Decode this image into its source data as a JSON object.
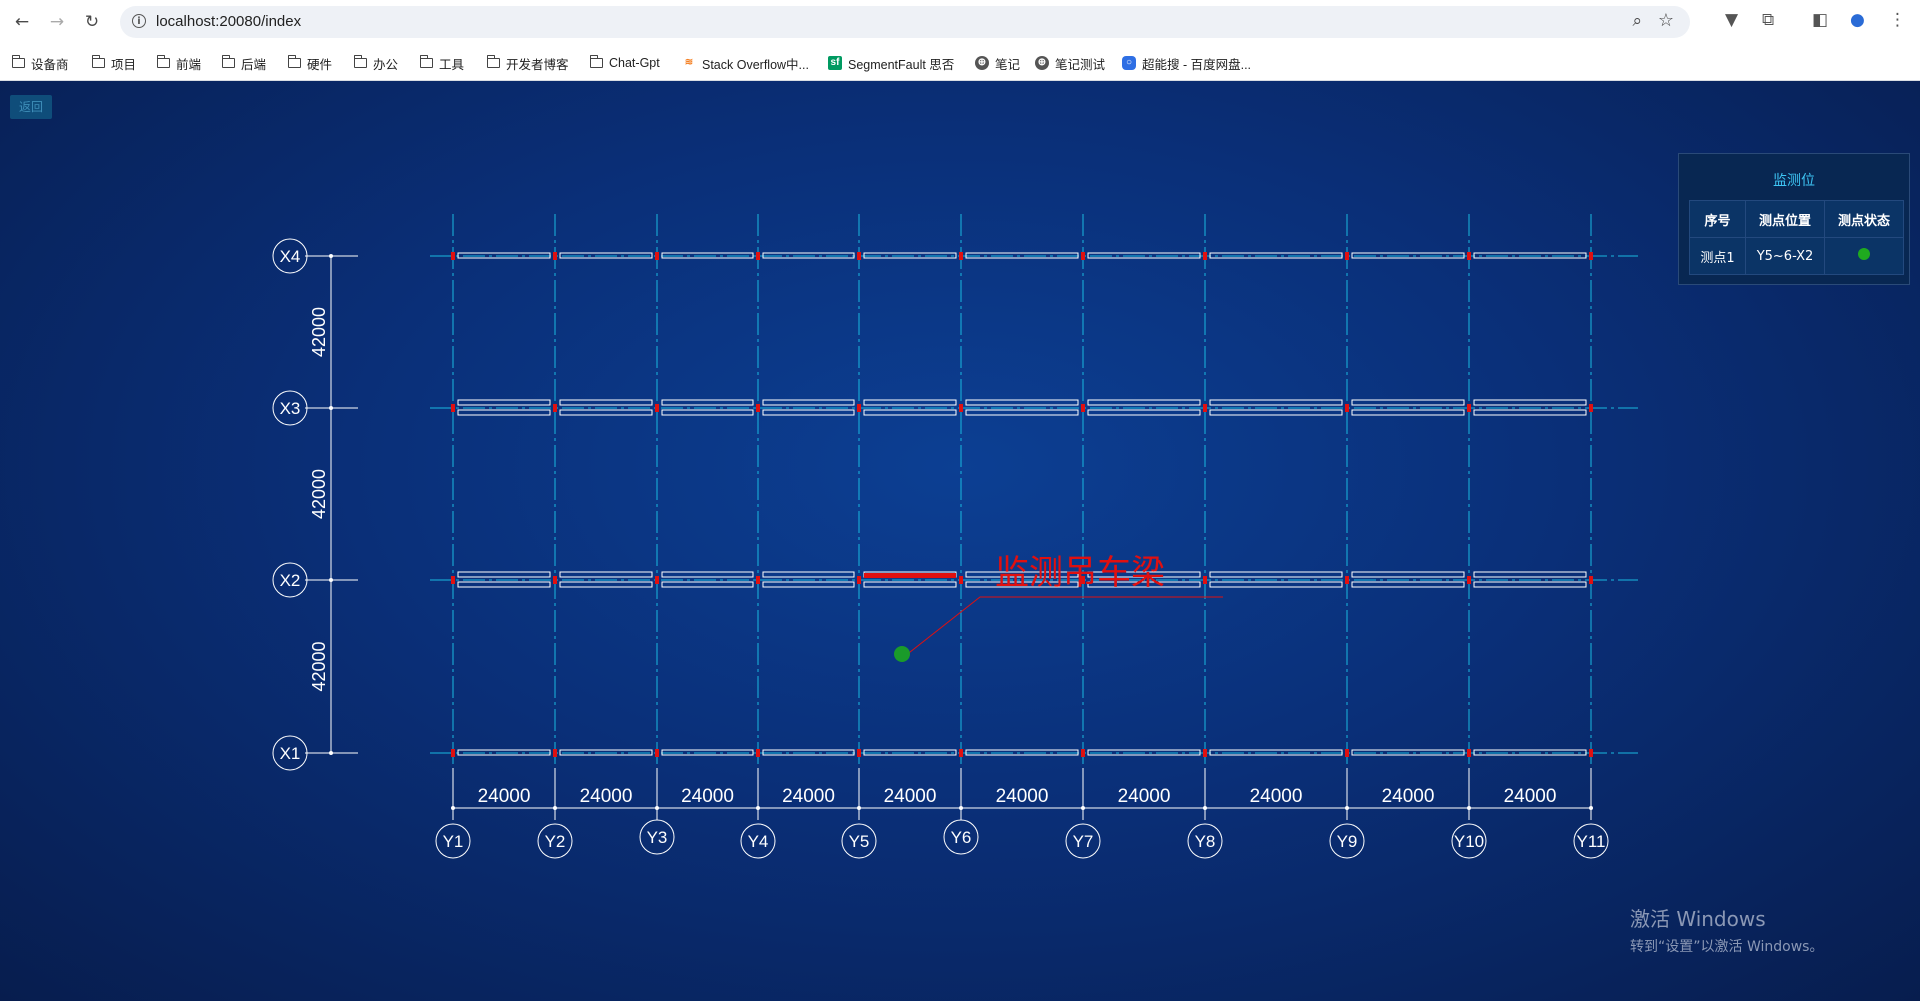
{
  "browser": {
    "url": "localhost:20080/index",
    "bookmarks": [
      {
        "label": "设备商",
        "icon": "folder-icon"
      },
      {
        "label": "项目",
        "icon": "folder-icon"
      },
      {
        "label": "前端",
        "icon": "folder-icon"
      },
      {
        "label": "后端",
        "icon": "folder-icon"
      },
      {
        "label": "硬件",
        "icon": "folder-icon"
      },
      {
        "label": "办公",
        "icon": "folder-icon"
      },
      {
        "label": "工具",
        "icon": "folder-icon"
      },
      {
        "label": "开发者博客",
        "icon": "folder-icon"
      },
      {
        "label": "Chat-Gpt",
        "icon": "folder-icon"
      },
      {
        "label": "Stack Overflow中...",
        "icon": "stackoverflow-icon"
      },
      {
        "label": "SegmentFault 思否",
        "icon": "segmentfault-icon"
      },
      {
        "label": "笔记",
        "icon": "globe-icon"
      },
      {
        "label": "笔记测试",
        "icon": "globe-icon"
      },
      {
        "label": "超能搜 - 百度网盘...",
        "icon": "search-app-icon"
      }
    ]
  },
  "page": {
    "back_label": "返回",
    "panel": {
      "title": "监测位",
      "headers": [
        "序号",
        "测点位置",
        "测点状态"
      ],
      "rows": [
        {
          "index": "测点1",
          "position": "Y5~6-X2",
          "status_color": "#1faa1f"
        }
      ]
    },
    "drawing": {
      "annotation": "监测吊车梁",
      "x_axes": [
        "X4",
        "X3",
        "X2",
        "X1"
      ],
      "x_dims": [
        "42000",
        "42000",
        "42000"
      ],
      "y_axes": [
        "Y1",
        "Y2",
        "Y3",
        "Y4",
        "Y5",
        "Y6",
        "Y7",
        "Y8",
        "Y9",
        "Y10",
        "Y11"
      ],
      "y_dims": [
        "24000",
        "24000",
        "24000",
        "24000",
        "24000",
        "24000",
        "24000",
        "24000",
        "24000",
        "24000"
      ],
      "colors": {
        "grid": "#19b9e0",
        "highlight": "#e01010",
        "sensor": "#1a9b2a",
        "line": "#ffffff"
      }
    }
  },
  "watermark": {
    "line1": "激活 Windows",
    "line2": "转到“设置”以激活 Windows。"
  }
}
